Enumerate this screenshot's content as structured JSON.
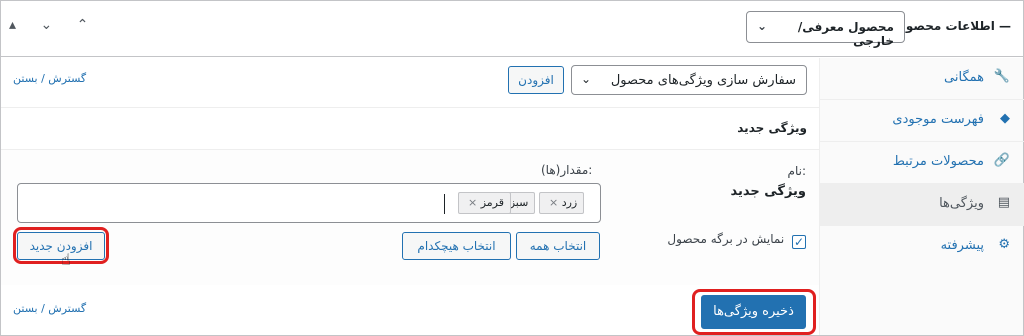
{
  "header": {
    "title": "اطلاعات محصول —",
    "product_type": "محصول معرفی/خارجی",
    "arrows": "▴ ⌄ ⌃"
  },
  "sidebar": {
    "items": [
      {
        "label": "همگانی",
        "icon": "wrench-icon",
        "glyph": "🔧"
      },
      {
        "label": "فهرست موجودی",
        "icon": "tag-icon",
        "glyph": "◆"
      },
      {
        "label": "محصولات مرتبط",
        "icon": "link-icon",
        "glyph": "🔗"
      },
      {
        "label": "ویژگی‌ها",
        "icon": "list-icon",
        "glyph": "▤"
      },
      {
        "label": "پیشرفته",
        "icon": "gear-icon",
        "glyph": "⚙"
      }
    ]
  },
  "main": {
    "expand_collapse": "گسترش / بستن",
    "attribute_select": "سفارش سازی ویژگی‌های محصول",
    "add_button": "افزودن",
    "new_attribute_heading": "ویژگی جدید",
    "name_label": "نام:",
    "name_value": "ویژگی جدید",
    "values_label": "مقدار(ها):",
    "tags": [
      "زرد",
      "سبز",
      "قرمز"
    ],
    "visible_on_product": "نمایش در برگه محصول",
    "select_all": "انتخاب همه",
    "select_none": "انتخاب هیچکدام",
    "add_new": "افزودن جدید",
    "save_button": "ذخیره ویژگی‌ها"
  },
  "colors": {
    "accent": "#2271b1",
    "highlight": "#e02020"
  }
}
